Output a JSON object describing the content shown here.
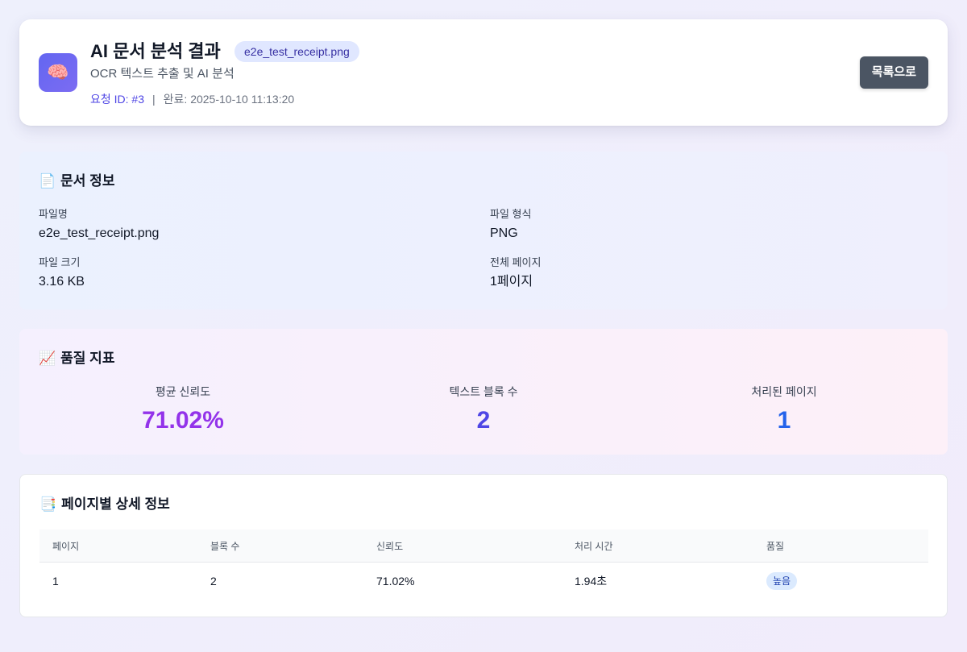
{
  "header": {
    "icon": "brain-icon",
    "title": "AI 문서 분석 결과",
    "filename_badge": "e2e_test_receipt.png",
    "subtitle": "OCR 텍스트 추출 및 AI 분석",
    "request_id": "요청 ID: #3",
    "separator": "|",
    "completed": "완료: 2025-10-10 11:13:20",
    "back_button": "목록으로"
  },
  "document_info": {
    "title": "문서 정보",
    "icon": "page-icon",
    "items": [
      {
        "label": "파일명",
        "value": "e2e_test_receipt.png"
      },
      {
        "label": "파일 형식",
        "value": "PNG"
      },
      {
        "label": "파일 크기",
        "value": "3.16 KB"
      },
      {
        "label": "전체 페이지",
        "value": "1페이지"
      }
    ]
  },
  "quality": {
    "title": "품질 지표",
    "icon": "chart-increasing-icon",
    "metrics": [
      {
        "label": "평균 신뢰도",
        "value": "71.02%",
        "color": "#9333ea"
      },
      {
        "label": "텍스트 블록 수",
        "value": "2",
        "color": "#4f46e5"
      },
      {
        "label": "처리된 페이지",
        "value": "1",
        "color": "#2563eb"
      }
    ]
  },
  "pages": {
    "title": "페이지별 상세 정보",
    "icon": "pages-icon",
    "columns": [
      "페이지",
      "블록 수",
      "신뢰도",
      "처리 시간",
      "품질"
    ],
    "rows": [
      {
        "page": "1",
        "blocks": "2",
        "confidence": "71.02%",
        "time": "1.94초",
        "quality": "높음"
      }
    ]
  }
}
